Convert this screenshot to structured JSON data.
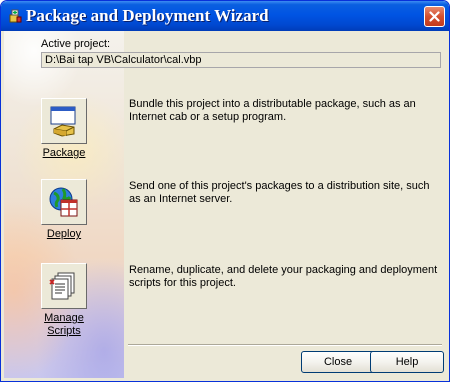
{
  "window": {
    "title": "Package and Deployment Wizard"
  },
  "icons": {
    "title": "wizard-app-icon",
    "close": "close-icon",
    "package": "package-box-icon",
    "deploy": "deploy-globe-icon",
    "scripts": "scripts-document-icon"
  },
  "project": {
    "label": "Active project:",
    "path": "D:\\Bai tap VB\\Calculator\\cal.vbp"
  },
  "actions": {
    "package": {
      "label": "Package",
      "description": "Bundle this project into a distributable package, such as an Internet cab or a setup program."
    },
    "deploy": {
      "label": "Deploy",
      "description": "Send one of this project's packages to a distribution site, such as an Internet server."
    },
    "manage": {
      "label_line1": "Manage",
      "label_line2": "Scripts",
      "description": "Rename, duplicate, and delete your packaging and deployment scripts for this project."
    }
  },
  "buttons": {
    "close": "Close",
    "help": "Help"
  }
}
